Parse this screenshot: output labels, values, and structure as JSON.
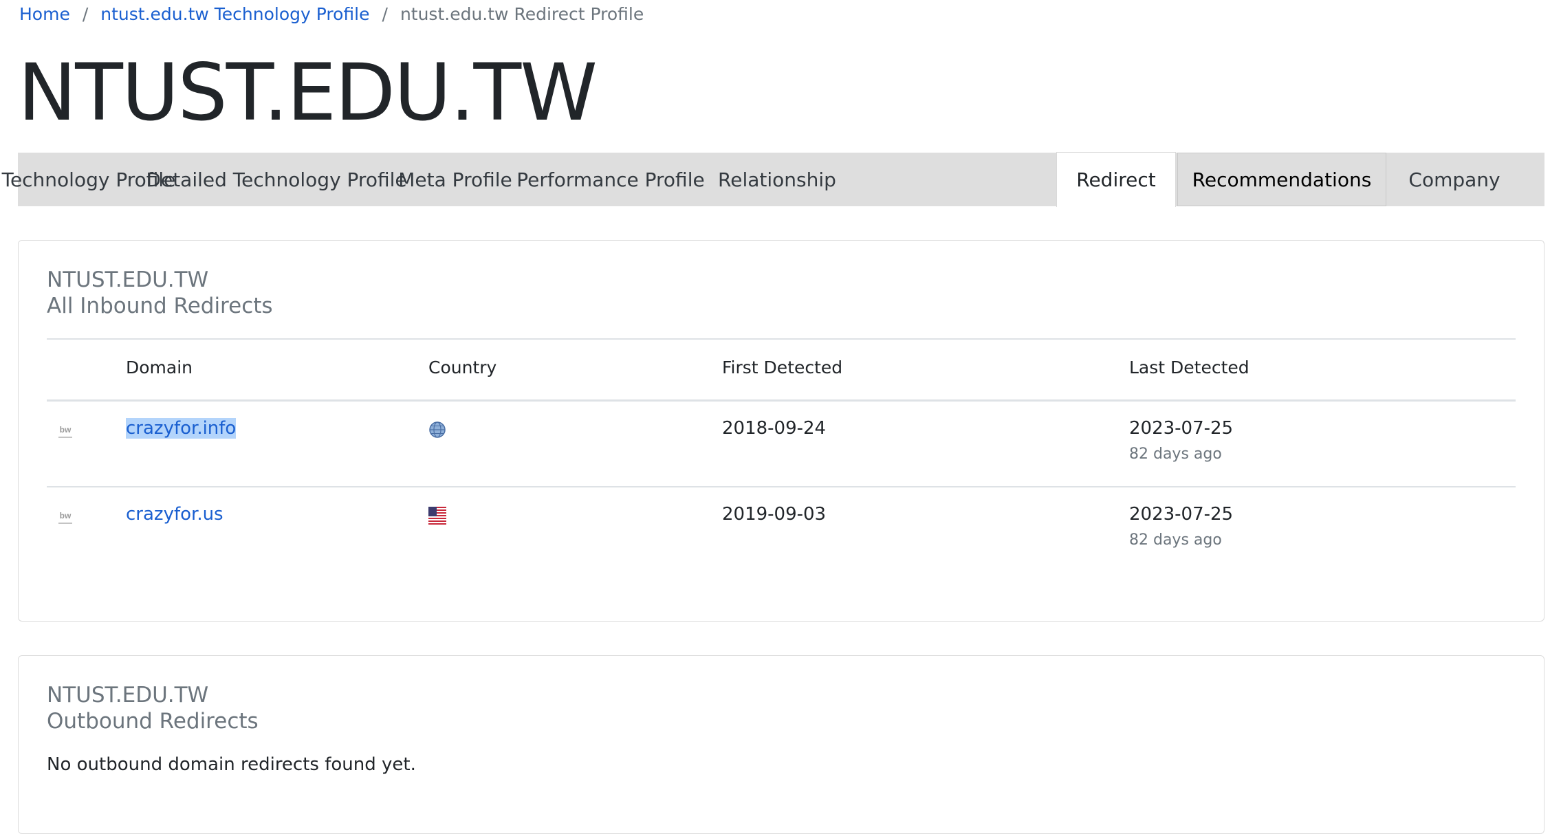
{
  "breadcrumb": {
    "home": "Home",
    "profile": "ntust.edu.tw Technology Profile",
    "separator": "/",
    "current": "ntust.edu.tw Redirect Profile"
  },
  "title": "NTUST.EDU.TW",
  "tabs": [
    {
      "label": "Technology Profile"
    },
    {
      "label": "Detailed Technology Profile"
    },
    {
      "label": "Meta Profile"
    },
    {
      "label": "Performance Profile"
    },
    {
      "label": "Relationship"
    },
    {
      "label": "Redirect",
      "active": true
    },
    {
      "label": "Recommendations"
    },
    {
      "label": "Company"
    }
  ],
  "inbound": {
    "title_line1": "NTUST.EDU.TW",
    "title_line2": "All Inbound Redirects",
    "headers": {
      "domain": "Domain",
      "country": "Country",
      "first": "First Detected",
      "last": "Last Detected"
    },
    "rows": [
      {
        "domain": "crazyfor.info",
        "country_icon": "globe-icon",
        "first": "2018-09-24",
        "last": "2023-07-25",
        "ago": "82 days ago",
        "selected": true
      },
      {
        "domain": "crazyfor.us",
        "country_icon": "us-flag-icon",
        "first": "2019-09-03",
        "last": "2023-07-25",
        "ago": "82 days ago"
      }
    ]
  },
  "outbound": {
    "title_line1": "NTUST.EDU.TW",
    "title_line2": "Outbound Redirects",
    "message": "No outbound domain redirects found yet."
  },
  "colors": {
    "link": "#1a5fd0",
    "tab_bar": "#dedede",
    "muted": "#6c757d",
    "selection": "#b3d4fb"
  }
}
